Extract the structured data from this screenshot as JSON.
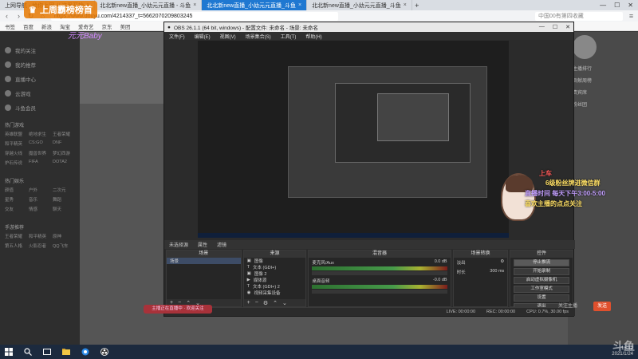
{
  "browser": {
    "tabs": [
      {
        "label": "上网导航 - 给你上网 从这里开始",
        "active": false
      },
      {
        "label": "北北新new直播_小幼元元直播 - 斗鱼",
        "active": false
      },
      {
        "label": "北北新new直播_小幼元元直播_斗鱼",
        "active": true
      },
      {
        "label": "北北新new直播_小幼元元直播_斗鱼",
        "active": false
      }
    ],
    "url": "https://www.douyu.com/4214337_t=5662070209803245",
    "search_placeholder": "中国00有第四收藏",
    "bookmarks": [
      "书签",
      "百度",
      "新浪",
      "淘宝",
      "爱奇艺",
      "京东",
      "美团"
    ]
  },
  "page": {
    "logo_banner": "上周霸榜榜首",
    "logo_sub": "元元Baby",
    "sidebar": {
      "top_items": [
        "我的关注",
        "我的推荐",
        "直播中心",
        "云游戏",
        "斗鱼会员"
      ],
      "section_1": "热门游戏",
      "grid_1": [
        "英雄联盟",
        "绝地求生",
        "王者荣耀",
        "和平精英",
        "CS:GO",
        "DNF",
        "穿越火线",
        "魔兽世界",
        "梦幻西游",
        "炉石传说",
        "FIFA",
        "DOTA2"
      ],
      "section_2": "热门娱乐",
      "grid_2": [
        "颜值",
        "户外",
        "二次元",
        "星秀",
        "音乐",
        "舞蹈",
        "交友",
        "情感",
        "聊天"
      ],
      "section_3": "手游推荐",
      "grid_3": [
        "王者荣耀",
        "和平精英",
        "原神",
        "第五人格",
        "火影忍者",
        "QQ飞车"
      ]
    },
    "red_pill": "主播正在直播中 · 欢迎关注",
    "follow_text": "关注主播",
    "send_label": "发送",
    "right_panel": {
      "rows": [
        "主播排行",
        "贡献周榜",
        "贵宾席",
        "粉丝团"
      ]
    }
  },
  "obs": {
    "title": "OBS 26.1.1 (64 bit, windows) - 配置文件: 未命名 - 场景: 未命名",
    "menu": [
      "文件(F)",
      "编辑(E)",
      "视图(V)",
      "场景集合(S)",
      "工具(T)",
      "帮助(H)"
    ],
    "scene_header": "未选择源",
    "scene_header_tabs": [
      "属性",
      "滤镜"
    ],
    "docks": {
      "scenes": {
        "title": "场景",
        "items": [
          "场景"
        ]
      },
      "sources": {
        "title": "来源",
        "items": [
          "图像",
          "文本 (GDI+)",
          "图像 2",
          "媒体源",
          "文本 (GDI+) 2",
          "视频采集设备"
        ]
      },
      "mixer": {
        "title": "混音器",
        "channels": [
          {
            "name": "麦克风/Aux",
            "db": "0.0 dB"
          },
          {
            "name": "桌面音频",
            "db": "-0.0 dB"
          }
        ]
      },
      "transitions": {
        "title": "场景转换",
        "type": "淡出",
        "duration_label": "时长",
        "duration": "300 ms"
      },
      "controls": {
        "title": "控件",
        "buttons": [
          "停止推流",
          "开始录制",
          "启动虚拟摄像机",
          "工作室模式",
          "设置",
          "退出"
        ]
      }
    },
    "status": {
      "live": "LIVE: 00:00:00",
      "rec": "REC: 00:00:00",
      "cpu": "CPU: 0.7%, 30.00 fps"
    }
  },
  "overlay": {
    "line1": "上车",
    "line2": "6级粉丝牌进微信群",
    "line3": "直播时间 每天下午3:00-5:00",
    "line4": "喜欢主播的点点关注"
  },
  "taskbar": {
    "time": "16:12",
    "date": "2021/1/24"
  },
  "watermark": "斗鱼"
}
